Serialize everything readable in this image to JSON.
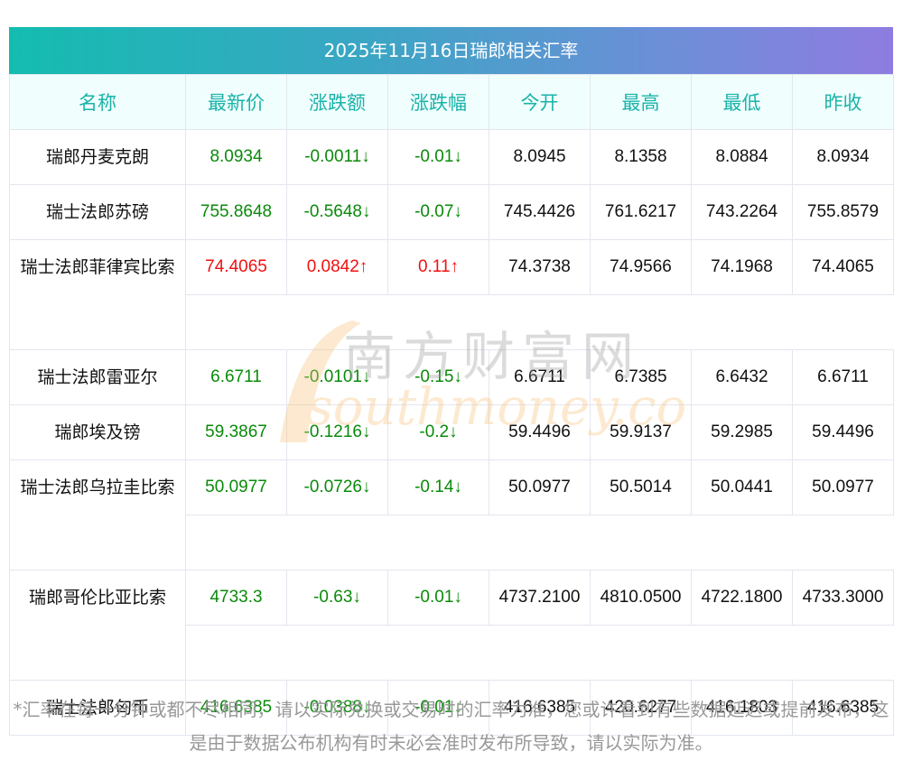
{
  "title": "2025年11月16日瑞郎相关汇率",
  "headers": [
    "名称",
    "最新价",
    "涨跌额",
    "涨跌幅",
    "今开",
    "最高",
    "最低",
    "昨收"
  ],
  "rows": [
    {
      "name": "瑞郎丹麦克朗",
      "dir": "down",
      "cells": [
        "8.0934",
        "-0.0011↓",
        "-0.01↓",
        "8.0945",
        "8.1358",
        "8.0884",
        "8.0934"
      ]
    },
    {
      "name": "瑞士法郎苏磅",
      "dir": "down",
      "cells": [
        "755.8648",
        "-0.5648↓",
        "-0.07↓",
        "745.4426",
        "761.6217",
        "743.2264",
        "755.8579"
      ]
    },
    {
      "name": "瑞士法郎菲律宾比索",
      "dir": "up",
      "cells": [
        "74.4065",
        "0.0842↑",
        "0.11↑",
        "74.3738",
        "74.9566",
        "74.1968",
        "74.4065"
      ]
    },
    {
      "name": "瑞士法郎雷亚尔",
      "dir": "down",
      "cells": [
        "6.6711",
        "-0.0101↓",
        "-0.15↓",
        "6.6711",
        "6.7385",
        "6.6432",
        "6.6711"
      ]
    },
    {
      "name": "瑞郎埃及镑",
      "dir": "down",
      "cells": [
        "59.3867",
        "-0.1216↓",
        "-0.2↓",
        "59.4496",
        "59.9137",
        "59.2985",
        "59.4496"
      ]
    },
    {
      "name": "瑞士法郎乌拉圭比索",
      "dir": "down",
      "cells": [
        "50.0977",
        "-0.0726↓",
        "-0.14↓",
        "50.0977",
        "50.5014",
        "50.0441",
        "50.0977"
      ]
    },
    {
      "name": "瑞郎哥伦比亚比索",
      "dir": "down",
      "cells": [
        "4733.3",
        "-0.63↓",
        "-0.01↓",
        "4737.2100",
        "4810.0500",
        "4722.1800",
        "4733.3000"
      ]
    },
    {
      "name": "瑞士法郎匈币",
      "dir": "down",
      "cells": [
        "416.6385",
        "-0.0388↓",
        "-0.01↓",
        "416.6385",
        "420.6277",
        "416.1803",
        "416.6385"
      ]
    }
  ],
  "watermark": {
    "cn": "南方财富网",
    "en": "southmoney.com"
  },
  "note": "*汇率在每一分钟或都不尽相同，请以实际兑换或交易时的汇率为准，您或许看到有些数据延迟或提前发布，这是由于数据公布机构有时未必会准时发布所导致，请以实际为准。",
  "colors": {
    "up": "#f01010",
    "down": "#0a8a0a",
    "header": "#1ab3a8"
  }
}
